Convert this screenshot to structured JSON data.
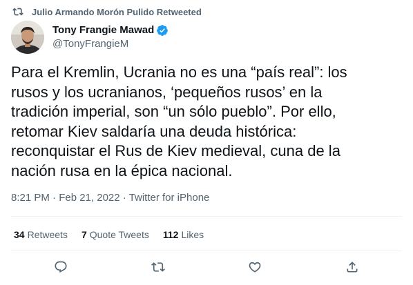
{
  "social_context": {
    "text": "Julio Armando Morón Pulido Retweeted",
    "icon": "retweet-icon"
  },
  "author": {
    "display_name": "Tony Frangie Mawad",
    "handle": "@TonyFrangieM",
    "verified": true,
    "verified_color": "#1d9bf0"
  },
  "tweet": {
    "text": "Para el Kremlin, Ucrania no es una “país real”: los\nrusos y los ucranianos, ‘pequeños rusos’ en la\ntradición imperial, son “un sólo pueblo”. Por ello,\nretomar Kiev saldaría una deuda histórica:\nreconquistar el Rus de Kiev medieval, cuna de la\nnación rusa en la épica nacional.",
    "timestamp": "8:21 PM · Feb 21, 2022 · Twitter for iPhone"
  },
  "stats": {
    "retweets_count": "34",
    "retweets_label": "Retweets",
    "quotes_count": "7",
    "quotes_label": "Quote Tweets",
    "likes_count": "112",
    "likes_label": "Likes"
  },
  "actions": {
    "reply_icon": "reply-icon",
    "retweet_icon": "retweet-icon",
    "like_icon": "heart-icon",
    "share_icon": "share-icon"
  }
}
